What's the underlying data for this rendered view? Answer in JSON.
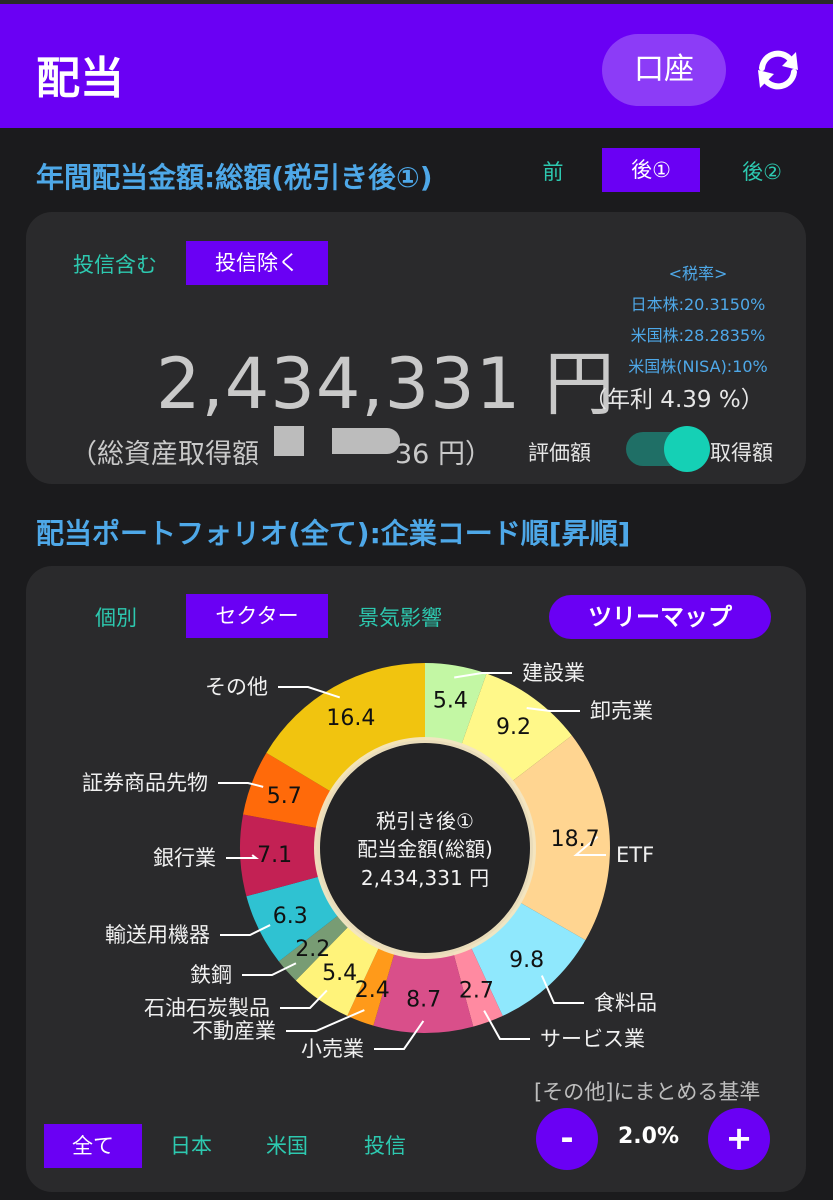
{
  "header": {
    "title": "配当",
    "account_label": "口座"
  },
  "annual": {
    "section_title": "年間配当金額:総額(税引き後①)",
    "tabs": [
      "前",
      "後①",
      "後②"
    ],
    "active_tab": "後①",
    "fund_filter": [
      "投信含む",
      "投信除く"
    ],
    "amount": "2,434,331 円",
    "tax": {
      "title": "<税率>",
      "jp": "日本株:20.3150%",
      "us": "米国株:28.2835%",
      "nisa": "米国株(NISA):10%"
    },
    "annual_yield": "（年利 4.39 %）",
    "cost_prefix": "（総資産取得額",
    "cost_suffix": "36 円）",
    "toggle_left": "評価額",
    "toggle_right": "取得額"
  },
  "portfolio": {
    "section_title": "配当ポートフォリオ(全て):企業コード順[昇順]",
    "view_tabs": [
      "個別",
      "セクター",
      "景気影響"
    ],
    "active_view": "セクター",
    "treemap_label": "ツリーマップ",
    "center": {
      "line1": "税引き後①",
      "line2": "配当金額(総額)",
      "line3": "2,434,331 円"
    },
    "market_tabs": [
      "全て",
      "日本",
      "米国",
      "投信"
    ],
    "threshold_label": "[その他]にまとめる基準",
    "threshold_value": "2.0%",
    "minus": "-",
    "plus": "+"
  },
  "chart_data": {
    "type": "pie",
    "unit": "%",
    "slices": [
      {
        "label": "建設業",
        "value": 5.4,
        "color": "#c3f7a4"
      },
      {
        "label": "卸売業",
        "value": 9.2,
        "color": "#fff889"
      },
      {
        "label": "ETF",
        "value": 18.7,
        "color": "#ffd591"
      },
      {
        "label": "食料品",
        "value": 9.8,
        "color": "#8fe8fd"
      },
      {
        "label": "サービス業",
        "value": 2.7,
        "color": "#ff8aa1"
      },
      {
        "label": "小売業",
        "value": 8.7,
        "color": "#d94f8a"
      },
      {
        "label": "不動産業",
        "value": 2.4,
        "color": "#ff9a1a"
      },
      {
        "label": "石油石炭製品",
        "value": 5.4,
        "color": "#fff37a"
      },
      {
        "label": "鉄鋼",
        "value": 2.2,
        "color": "#789c74"
      },
      {
        "label": "輸送用機器",
        "value": 6.3,
        "color": "#2fc2d2"
      },
      {
        "label": "銀行業",
        "value": 7.1,
        "color": "#c32154"
      },
      {
        "label": "証券商品先物",
        "value": 5.7,
        "color": "#ff6a0a"
      },
      {
        "label": "その他",
        "value": 16.4,
        "color": "#f1c40f"
      }
    ]
  }
}
